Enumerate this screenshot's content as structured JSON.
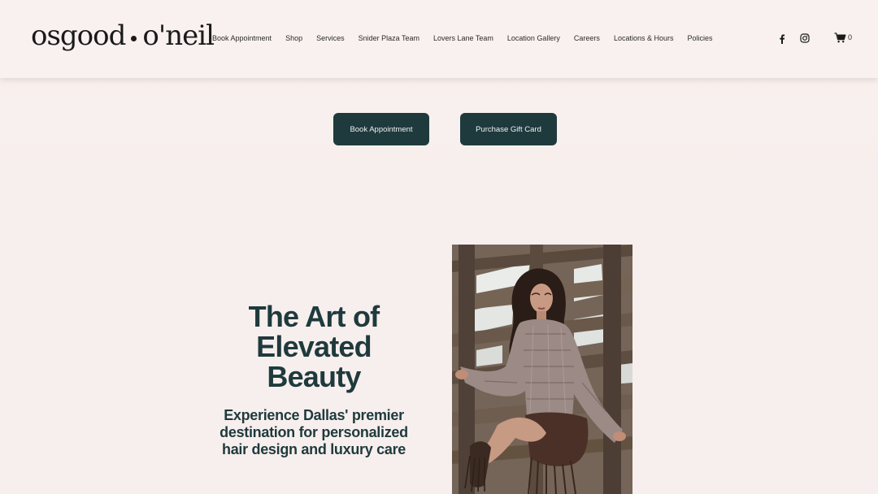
{
  "header": {
    "logo_left": "osgood",
    "logo_right": "o'neil",
    "nav": [
      "Book Appointment",
      "Shop",
      "Services",
      "Snider Plaza Team",
      "Lovers Lane Team",
      "Location Gallery",
      "Careers",
      "Locations & Hours",
      "Policies"
    ],
    "social_icons": [
      "facebook-icon",
      "instagram-icon"
    ],
    "cart_icon": "cart-icon",
    "cart_count": "0"
  },
  "cta": {
    "book_label": "Book Appointment",
    "gift_label": "Purchase Gift Card"
  },
  "hero": {
    "headline_lines": [
      "The Art of",
      "Elevated",
      "Beauty"
    ],
    "subheadline_lines": [
      "Experience Dallas' premier",
      "destination for personalized",
      "hair design and luxury care"
    ],
    "photo_description": "woman in snakeskin blouse sitting on wooden fence"
  },
  "colors": {
    "background": "#f7efed",
    "header": "#f9f1ef",
    "accent": "#1f3a3d",
    "button_text": "#eef2f2"
  }
}
